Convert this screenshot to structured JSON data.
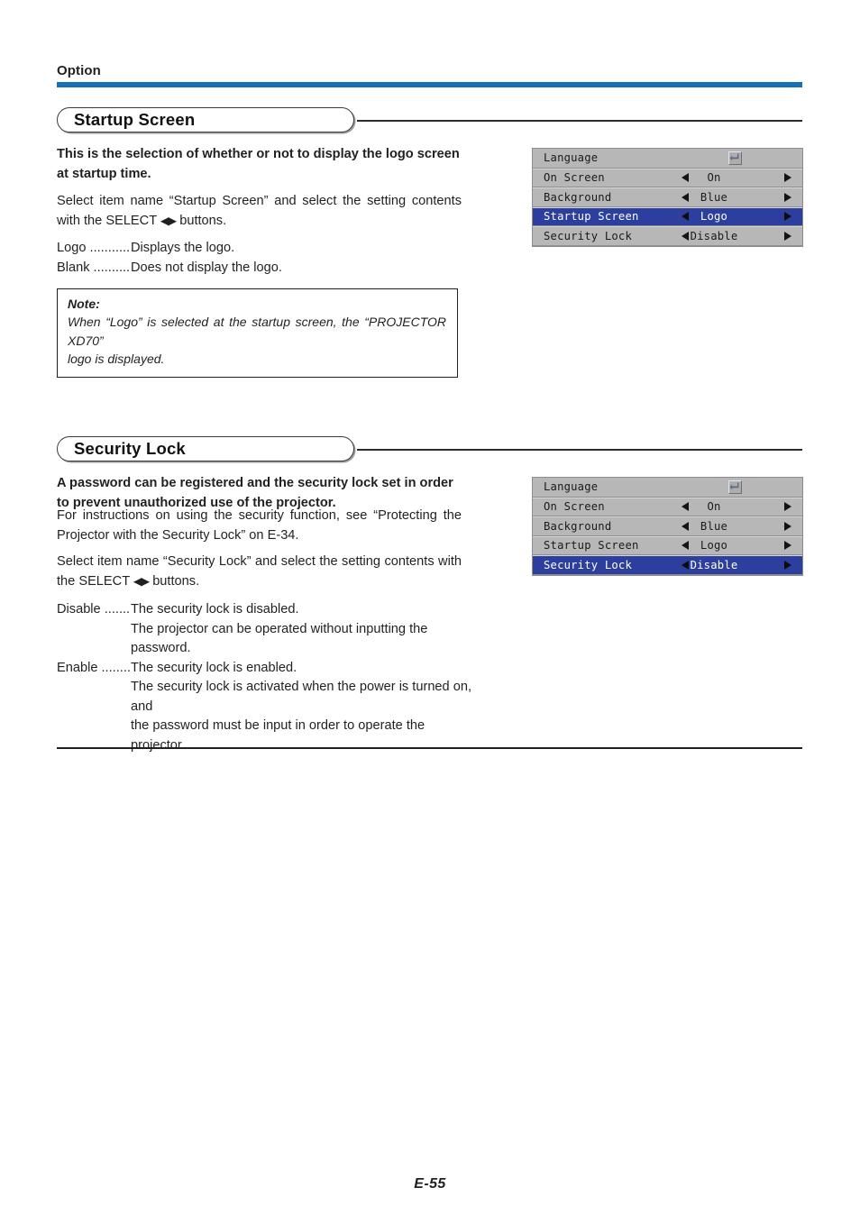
{
  "document": {
    "running_head": "Option",
    "page_number": "E-55",
    "accent_color": "#1570b8",
    "highlight_color": "#2d3f9e",
    "menu_bg_color": "#b7b7b7"
  },
  "sections": [
    {
      "id": "startup-screen",
      "title": "Startup Screen",
      "intro_bold": [
        "This is the selection of whether or not to display the logo screen",
        "at startup time."
      ],
      "paragraph": [
        "Select item name “Startup Screen” and select the setting contents",
        "with the SELECT ◀▶ buttons."
      ],
      "paragraph_prefix": "Select item name “Startup Screen” and select the setting contents",
      "paragraph_suffix_a": "with the SELECT ",
      "paragraph_arrows": "◀▶",
      "paragraph_suffix_b": " buttons.",
      "options": [
        {
          "term": "Logo ...........",
          "desc": "Displays the logo."
        },
        {
          "term": "Blank ..........",
          "desc": "Does not display the logo."
        }
      ],
      "note": {
        "title": "Note:",
        "body": [
          "When “Logo” is selected at the startup screen, the “PROJECTOR XD70”",
          "logo is displayed."
        ]
      }
    },
    {
      "id": "security-lock",
      "title": "Security Lock",
      "intro_bold": [
        "A password can be registered and the security lock set in order",
        "to prevent unauthorized use of the projector."
      ],
      "intro_plain": [
        "For instructions on using the security function, see “Protecting the",
        "Projector with the Security Lock” on E-34."
      ],
      "paragraph_prefix": "Select item name “Security Lock” and select the setting contents with",
      "paragraph_suffix_a": "the SELECT ",
      "paragraph_arrows": "◀▶",
      "paragraph_suffix_b": " buttons.",
      "options": [
        {
          "term": "Disable .......",
          "desc": "The security lock is disabled.",
          "cont": "The projector can be operated without inputting the password."
        },
        {
          "term": "Enable .........",
          "desc": "The security lock is enabled.",
          "cont": "The security lock is activated when the power is turned on, and",
          "cont2": "the password must be input in order to operate the projector."
        }
      ]
    }
  ],
  "osd_menus": [
    {
      "id": "osd-startup-screen",
      "rows": [
        {
          "name": "Language",
          "value": "",
          "control": "enter",
          "selected": false
        },
        {
          "name": "On Screen",
          "value": "On",
          "control": "arrows",
          "selected": false
        },
        {
          "name": "Background",
          "value": "Blue",
          "control": "arrows",
          "selected": false
        },
        {
          "name": "Startup Screen",
          "value": "Logo",
          "control": "arrows",
          "selected": true
        },
        {
          "name": "Security Lock",
          "value": "Disable",
          "control": "arrows",
          "selected": false
        }
      ]
    },
    {
      "id": "osd-security-lock",
      "rows": [
        {
          "name": "Language",
          "value": "",
          "control": "enter",
          "selected": false
        },
        {
          "name": "On Screen",
          "value": "On",
          "control": "arrows",
          "selected": false
        },
        {
          "name": "Background",
          "value": "Blue",
          "control": "arrows",
          "selected": false
        },
        {
          "name": "Startup Screen",
          "value": "Logo",
          "control": "arrows",
          "selected": false
        },
        {
          "name": "Security Lock",
          "value": "Disable",
          "control": "arrows",
          "selected": true
        }
      ]
    }
  ]
}
